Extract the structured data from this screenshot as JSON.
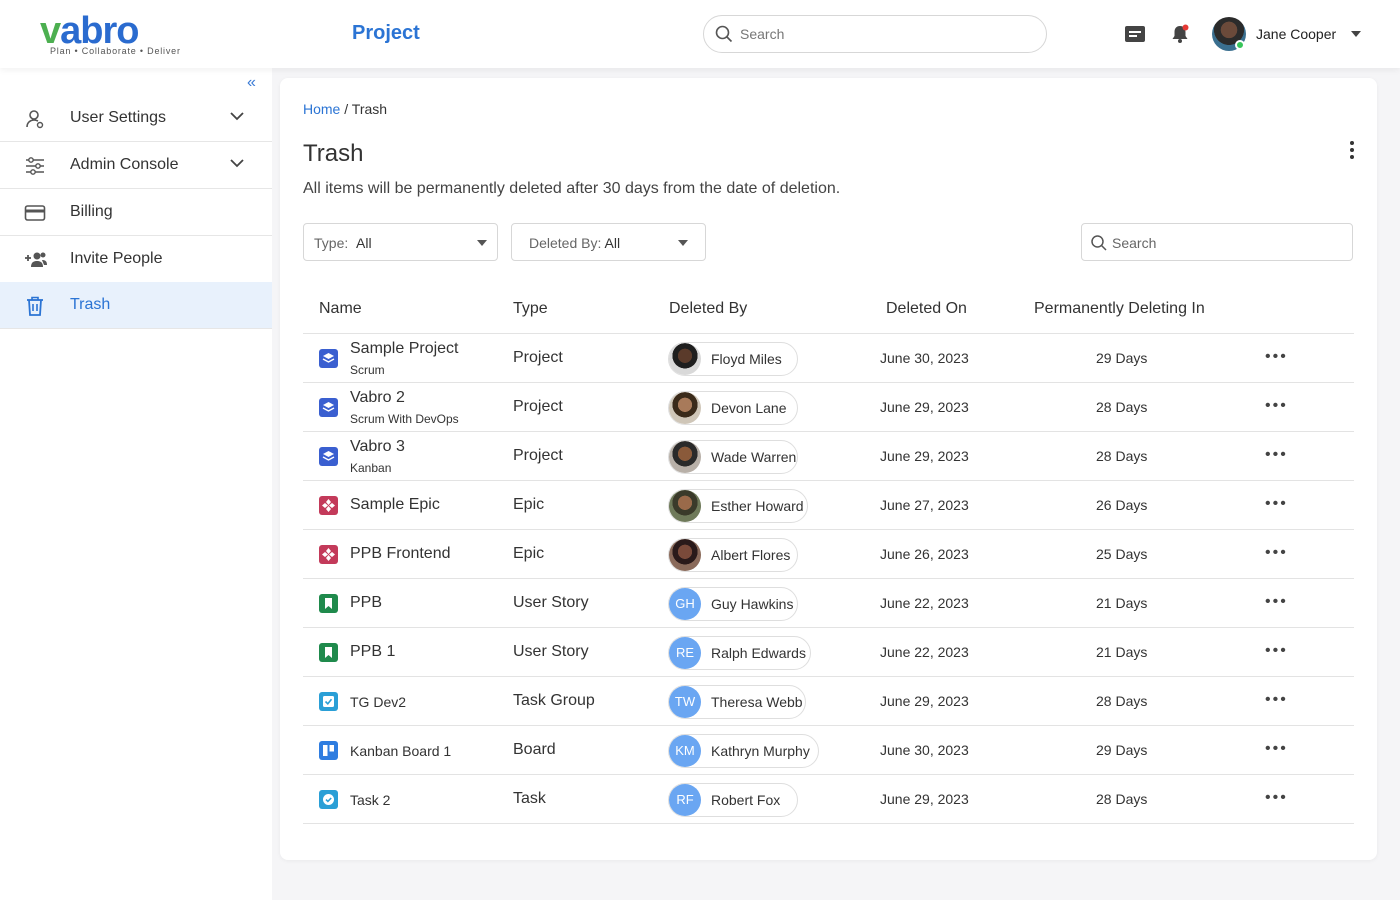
{
  "app": {
    "logo_text": "vabro",
    "logo_tagline": "Plan • Collaborate • Deliver",
    "header_title": "Project",
    "search_placeholder": "Search",
    "user_name": "Jane Cooper"
  },
  "sidebar": {
    "items": [
      {
        "label": "User Settings",
        "icon": "user-icon",
        "has_chevron": true,
        "active": false
      },
      {
        "label": "Admin Console",
        "icon": "sliders-icon",
        "has_chevron": true,
        "active": false
      },
      {
        "label": "Billing",
        "icon": "card-icon",
        "has_chevron": false,
        "active": false
      },
      {
        "label": "Invite People",
        "icon": "add-people-icon",
        "has_chevron": false,
        "active": false
      },
      {
        "label": "Trash",
        "icon": "trash-icon",
        "has_chevron": false,
        "active": true
      }
    ]
  },
  "breadcrumb": {
    "home": "Home",
    "separator": " / ",
    "current": "Trash"
  },
  "page": {
    "title": "Trash",
    "subtitle": "All items will be permanently deleted after 30 days from the date of deletion."
  },
  "filters": {
    "type_label": "Type:",
    "type_value": "All",
    "deleted_by_label": "Deleted By:",
    "deleted_by_value": "All",
    "search_placeholder": "Search"
  },
  "table": {
    "headers": [
      "Name",
      "Type",
      "Deleted By",
      "Deleted On",
      "Permanently Deleting In"
    ],
    "rows": [
      {
        "name": "Sample Project",
        "sub": "Scrum",
        "item_icon": "project-icon",
        "type": "Project",
        "by": "Floyd Miles",
        "initials": "",
        "on": "June 30, 2023",
        "days": "29 Days"
      },
      {
        "name": "Vabro 2",
        "sub": "Scrum With DevOps",
        "item_icon": "project-icon",
        "type": "Project",
        "by": "Devon Lane",
        "initials": "",
        "on": "June 29, 2023",
        "days": "28 Days"
      },
      {
        "name": "Vabro 3",
        "sub": "Kanban",
        "item_icon": "project-icon",
        "type": "Project",
        "by": "Wade Warren",
        "initials": "",
        "on": "June 29, 2023",
        "days": "28 Days"
      },
      {
        "name": "Sample Epic",
        "sub": "",
        "item_icon": "epic-icon",
        "type": "Epic",
        "by": "Esther Howard",
        "initials": "",
        "on": "June 27, 2023",
        "days": "26 Days"
      },
      {
        "name": "PPB Frontend",
        "sub": "",
        "item_icon": "epic-icon",
        "type": "Epic",
        "by": "Albert Flores",
        "initials": "",
        "on": "June 26, 2023",
        "days": "25 Days"
      },
      {
        "name": "PPB",
        "sub": "",
        "item_icon": "user-story-icon",
        "type": "User Story",
        "by": "Guy Hawkins",
        "initials": "GH",
        "on": "June 22, 2023",
        "days": "21 Days"
      },
      {
        "name": "PPB 1",
        "sub": "",
        "item_icon": "user-story-icon",
        "type": "User Story",
        "by": "Ralph Edwards",
        "initials": "RE",
        "on": "June 22, 2023",
        "days": "21 Days"
      },
      {
        "name": "TG Dev2",
        "sub": "",
        "item_icon": "task-group-icon",
        "type": "Task Group",
        "by": "Theresa Webb",
        "initials": "TW",
        "on": "June 29, 2023",
        "days": "28 Days"
      },
      {
        "name": "Kanban Board 1",
        "sub": "",
        "item_icon": "board-icon",
        "type": "Board",
        "by": "Kathryn Murphy",
        "initials": "KM",
        "on": "June 30, 2023",
        "days": "29 Days"
      },
      {
        "name": "Task 2",
        "sub": "",
        "item_icon": "task-icon",
        "type": "Task",
        "by": "Robert Fox",
        "initials": "RF",
        "on": "June 29, 2023",
        "days": "28 Days"
      }
    ]
  },
  "colors": {
    "accent": "#2b74d4",
    "project": "#3a5fd0",
    "epic": "#c33a5a",
    "user_story": "#1f8a4c",
    "task_group": "#2a9fd6",
    "board": "#2f7de0",
    "task": "#2a9fd6",
    "initials_avatar": "#6aa6f2"
  }
}
